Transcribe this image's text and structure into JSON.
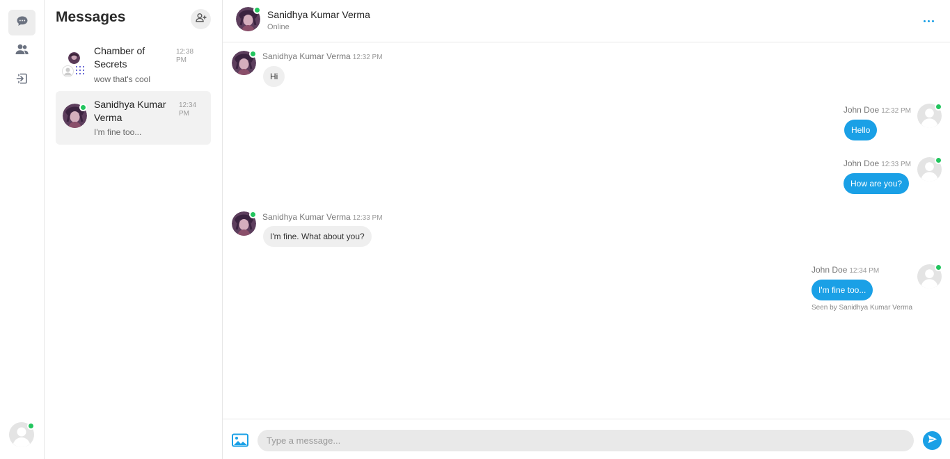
{
  "rail": {
    "items": [
      {
        "icon": "chat-bubble-icon",
        "active": true
      },
      {
        "icon": "users-icon",
        "active": false
      },
      {
        "icon": "logout-icon",
        "active": false
      }
    ],
    "colors": {
      "icon": "#6b7280",
      "online": "#22c55e"
    }
  },
  "sidebar": {
    "title": "Messages",
    "add_icon": "add-user-icon",
    "conversations": [
      {
        "name": "Chamber of Secrets",
        "preview": "wow that's cool",
        "time": "12:38 PM",
        "type": "group",
        "active": false
      },
      {
        "name": "Sanidhya Kumar Verma",
        "preview": "I'm fine too...",
        "time": "12:34 PM",
        "type": "direct",
        "online": true,
        "active": true
      }
    ]
  },
  "chat": {
    "header": {
      "name": "Sanidhya Kumar Verma",
      "status": "Online",
      "more_icon": "more-horizontal-icon"
    },
    "messages": [
      {
        "author": "Sanidhya Kumar Verma",
        "time": "12:32 PM",
        "text": "Hi",
        "direction": "in"
      },
      {
        "author": "John Doe",
        "time": "12:32 PM",
        "text": "Hello",
        "direction": "out"
      },
      {
        "author": "John Doe",
        "time": "12:33 PM",
        "text": "How are you?",
        "direction": "out"
      },
      {
        "author": "Sanidhya Kumar Verma",
        "time": "12:33 PM",
        "text": "I'm fine. What about you?",
        "direction": "in"
      },
      {
        "author": "John Doe",
        "time": "12:34 PM",
        "text": "I'm fine too...",
        "direction": "out"
      }
    ],
    "seen_text": "Seen by Sanidhya Kumar Verma",
    "composer": {
      "placeholder": "Type a message...",
      "image_icon": "image-icon",
      "send_icon": "send-icon"
    },
    "colors": {
      "accent": "#1aa0e6",
      "bubble_in": "#efefef",
      "online": "#22c55e"
    }
  }
}
